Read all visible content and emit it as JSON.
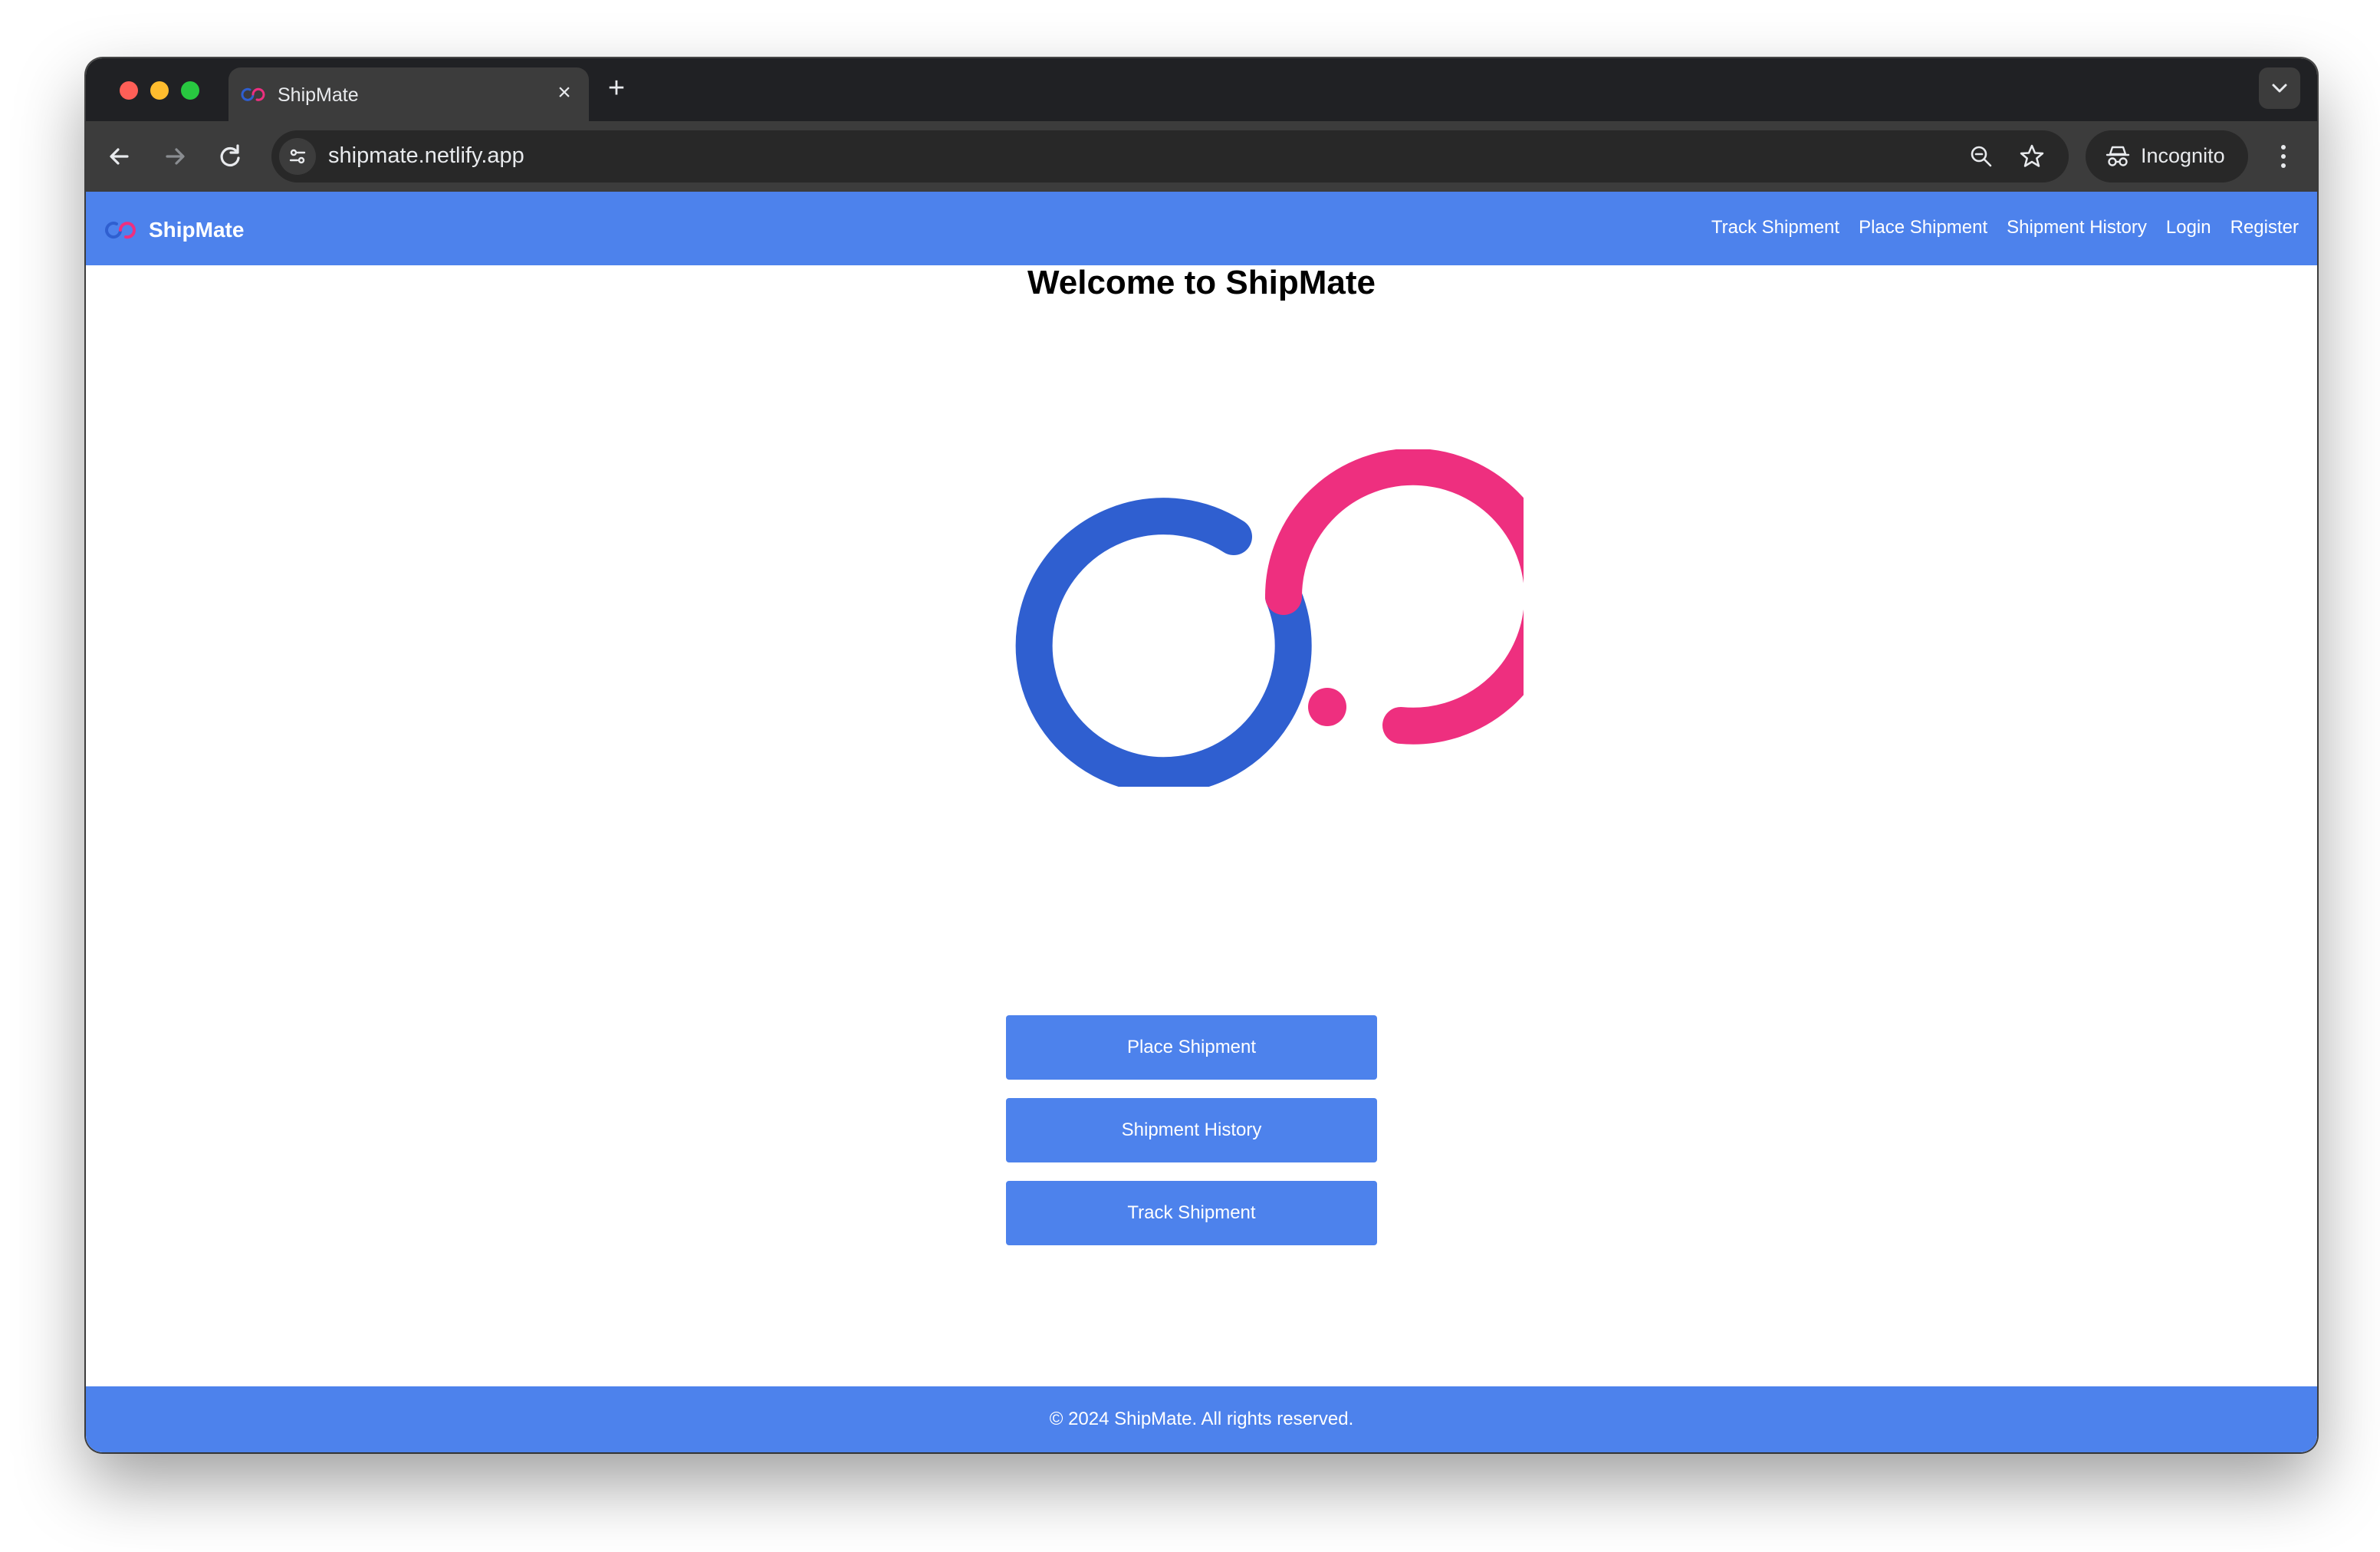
{
  "browser": {
    "tab": {
      "title": "ShipMate",
      "favicon": "shipmate-logo-icon",
      "close_icon": "close-icon"
    },
    "new_tab_icon": "plus-icon",
    "tab_menu_icon": "chevron-down-icon",
    "nav": {
      "back_icon": "arrow-left-icon",
      "forward_icon": "arrow-right-icon",
      "reload_icon": "reload-icon"
    },
    "omnibox": {
      "url": "shipmate.netlify.app",
      "site_info_icon": "tune-icon",
      "zoom_icon": "zoom-icon",
      "bookmark_icon": "star-icon"
    },
    "incognito": {
      "label": "Incognito",
      "icon": "incognito-icon"
    },
    "menu_icon": "more-vert-icon"
  },
  "site": {
    "brand": "ShipMate",
    "nav_links": [
      "Track Shipment",
      "Place Shipment",
      "Shipment History",
      "Login",
      "Register"
    ],
    "heading": "Welcome to ShipMate",
    "actions": [
      "Place Shipment",
      "Shipment History",
      "Track Shipment"
    ],
    "footer": "© 2024 ShipMate. All rights reserved."
  },
  "colors": {
    "primary": "#4d82ec",
    "logo_blue": "#2f5fd0",
    "logo_pink": "#ee2f7f",
    "chrome_dark": "#202124",
    "chrome_toolbar": "#3c3c3c"
  }
}
